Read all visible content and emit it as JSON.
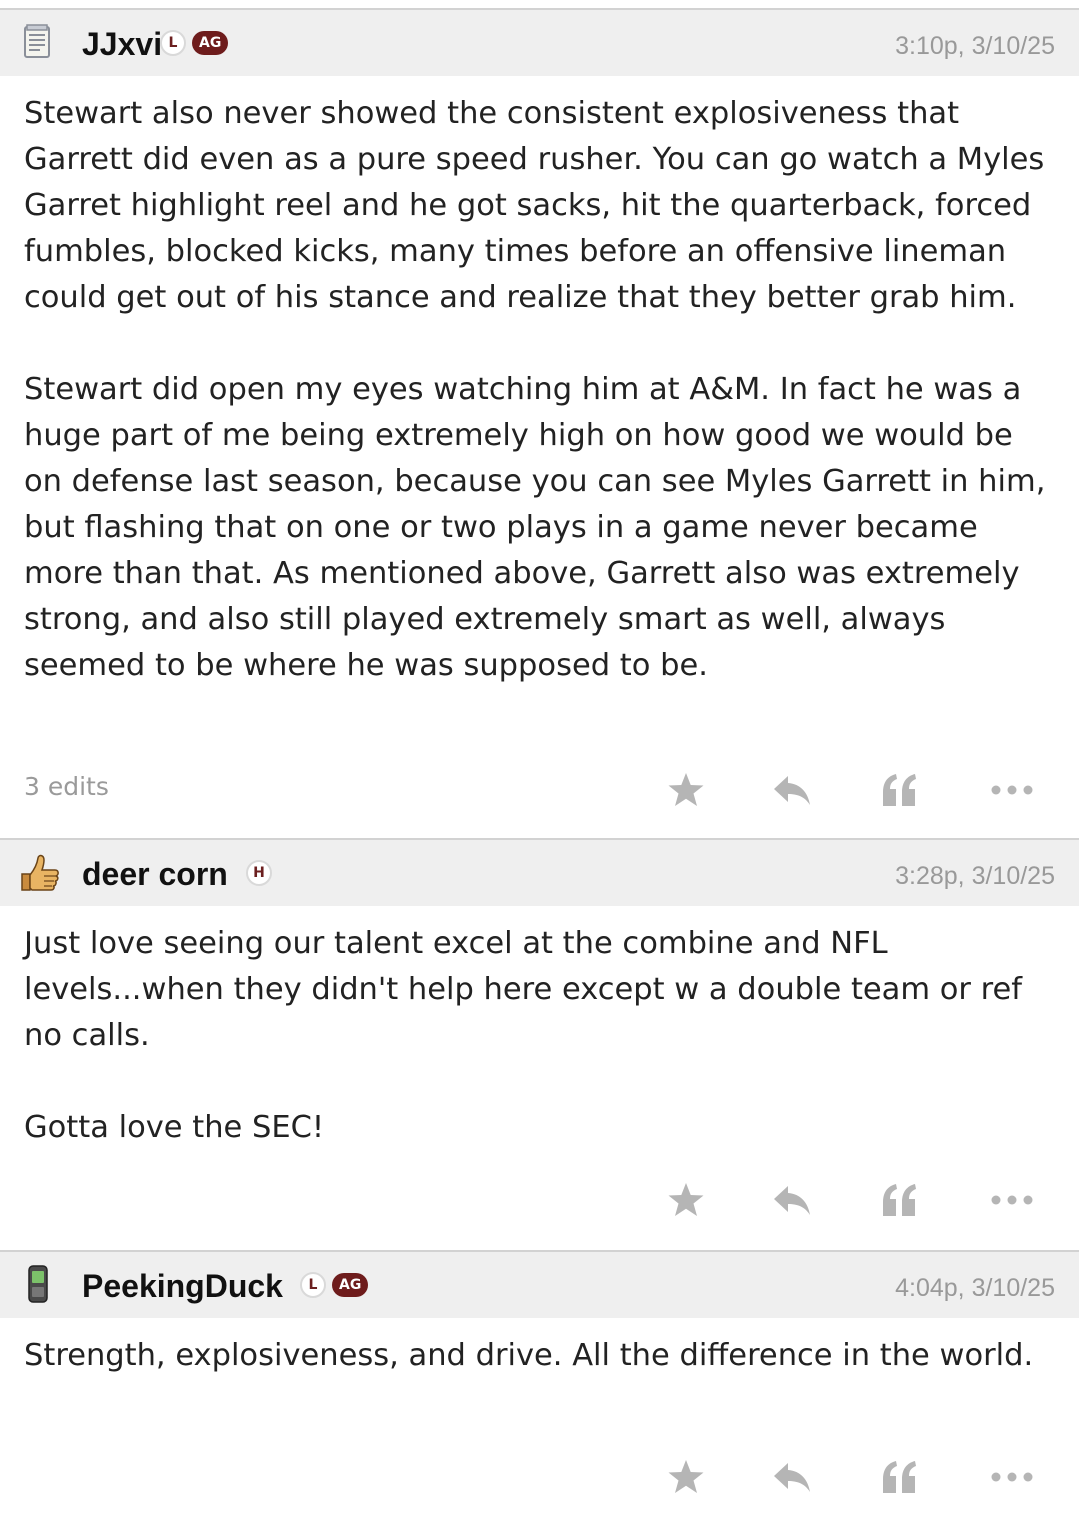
{
  "posts": [
    {
      "username": "JJxvi",
      "badges": [
        "L",
        "AG"
      ],
      "timestamp": "3:10p, 3/10/25",
      "avatar_icon": "notepad-icon",
      "paragraphs": [
        "Stewart also never showed the consistent explosiveness that Garrett did even as a pure speed rusher. You can go watch a Myles Garret highlight reel and he got sacks, hit the quarterback, forced fumbles, blocked kicks, many times before an offensive lineman could get out of his stance and realize that they better grab him.",
        "Stewart did open my eyes watching him at A&M. In fact he was a huge part of me being extremely high on how good we would be on defense last season, because you can see Myles Garrett in him, but flashing that on one or two plays in a game never became more than that. As mentioned above, Garrett also was extremely strong, and also still played extremely smart as well, always seemed to be where he was supposed to be."
      ],
      "edits": "3 edits"
    },
    {
      "username": "deer corn",
      "badges": [
        "H"
      ],
      "timestamp": "3:28p, 3/10/25",
      "avatar_icon": "thumbs-up-icon",
      "paragraphs": [
        "Just love seeing our talent excel at the combine and NFL levels...when they didn't help here except w a double team or ref no calls.",
        "Gotta love the SEC!"
      ],
      "edits": ""
    },
    {
      "username": "PeekingDuck",
      "badges": [
        "L",
        "AG"
      ],
      "timestamp": "4:04p, 3/10/25",
      "avatar_icon": "cellphone-icon",
      "paragraphs": [
        "Strength, explosiveness, and drive. All the difference in the world."
      ],
      "edits": ""
    }
  ],
  "actions": [
    "star-icon",
    "reply-icon",
    "quote-icon",
    "more-icon"
  ],
  "colors": {
    "header_bg": "#efefef",
    "badge_maroon": "#6e1c1c",
    "icon_gray": "#b5b5b5",
    "timestamp_gray": "#999999"
  }
}
